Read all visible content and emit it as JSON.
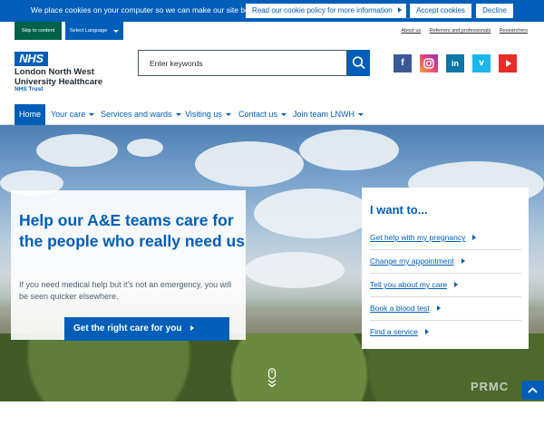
{
  "cookie": {
    "message": "We place cookies on your computer so we can make our site better.",
    "policy_label": "Read our cookie policy for more information",
    "accept_label": "Accept cookies",
    "decline_label": "Decline"
  },
  "utility": {
    "skip_label": "Skip to content",
    "language_label": "Select Language",
    "links": [
      "About us",
      "Referrers and professionals",
      "Researchers"
    ]
  },
  "header": {
    "logo_text": "NHS",
    "org_name": "London North West University Healthcare",
    "org_trust": "NHS Trust",
    "search_placeholder": "Enter keywords",
    "social": [
      "facebook-icon",
      "instagram-icon",
      "linkedin-icon",
      "vimeo-icon",
      "youtube-icon"
    ]
  },
  "nav": {
    "items": [
      {
        "label": "Home",
        "active": true
      },
      {
        "label": "Your care",
        "dropdown": true
      },
      {
        "label": "Services and wards",
        "dropdown": true
      },
      {
        "label": "Visiting us",
        "dropdown": true
      },
      {
        "label": "Contact us",
        "dropdown": true
      },
      {
        "label": "Join team LNWH",
        "dropdown": true
      }
    ]
  },
  "hero": {
    "title": "Help our A&E teams care for the people who really need us",
    "text": "If you need medical help but it's not an emergency, you will be seen quicker elsewhere.",
    "button_label": "Get the right care for you",
    "watermark": "PRMC"
  },
  "want": {
    "title": "I want to...",
    "items": [
      "Get help with my pregnancy",
      "Change my appointment",
      "Tell you about my care",
      "Book a blood test",
      "Find a service"
    ]
  },
  "colors": {
    "brand_blue": "#005eb8",
    "skip_green": "#00624a",
    "text_dark": "#212b32"
  }
}
